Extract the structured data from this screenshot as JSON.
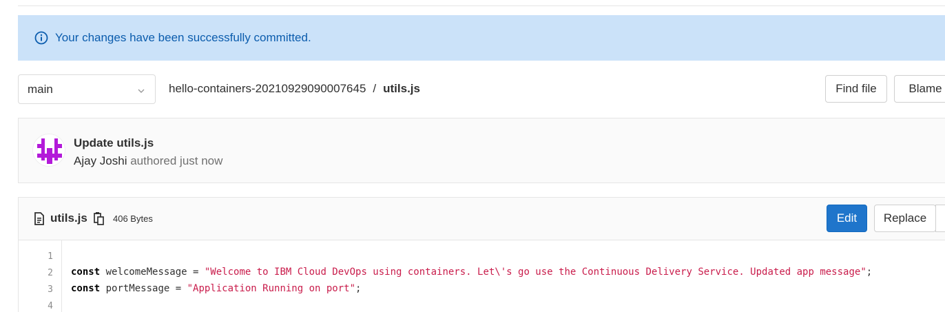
{
  "alert": {
    "icon": "info-icon",
    "text": "Your changes have been successfully committed.",
    "color": "#0b5cad",
    "background": "#cbe2f9"
  },
  "branch": {
    "selected": "main",
    "icon": "chevron-down-icon"
  },
  "breadcrumb": {
    "project": "hello-containers-20210929090007645",
    "separator": "/",
    "file": "utils.js"
  },
  "toolbar": {
    "find_file_label": "Find file",
    "blame_label": "Blame"
  },
  "commit": {
    "title": "Update utils.js",
    "author": "Ajay Joshi",
    "action": "authored just now",
    "avatar_icon": "identicon-avatar",
    "avatar_color": "#b31ad9"
  },
  "file": {
    "icon": "file-icon",
    "name": "utils.js",
    "copy_icon": "copy-icon",
    "size": "406 Bytes",
    "edit_label": "Edit",
    "replace_label": "Replace",
    "edit_color": "#1f75cb"
  },
  "code": {
    "lines": [
      {
        "number": "1"
      },
      {
        "number": "2",
        "keyword": "const",
        "rest": " welcomeMessage = ",
        "string": "\"Welcome to IBM Cloud DevOps using containers. Let\\'s go use the Continuous Delivery Service. Updated app message\"",
        "tail": ";"
      },
      {
        "number": "3",
        "keyword": "const",
        "rest": " portMessage = ",
        "string": "\"Application Running on port\"",
        "tail": ";"
      },
      {
        "number": "4"
      }
    ]
  }
}
